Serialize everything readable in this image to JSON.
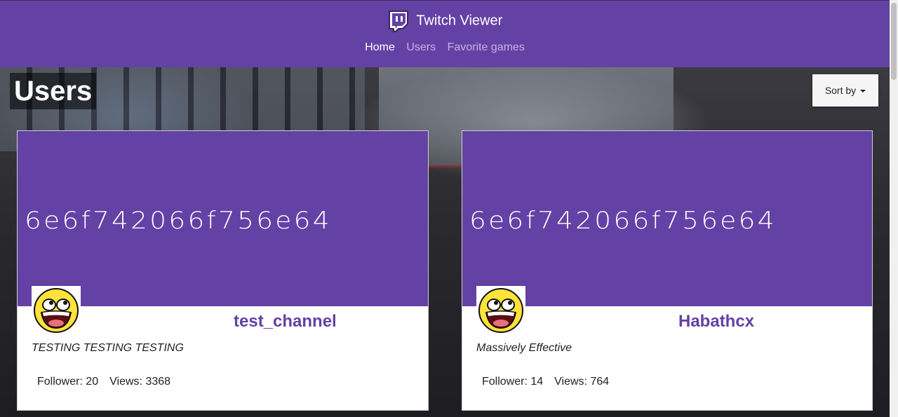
{
  "app": {
    "title": "Twitch Viewer"
  },
  "nav": {
    "items": [
      {
        "label": "Home",
        "active": true
      },
      {
        "label": "Users",
        "active": false
      },
      {
        "label": "Favorite games",
        "active": false
      }
    ]
  },
  "page": {
    "title": "Users",
    "sort_label": "Sort by"
  },
  "colors": {
    "brand": "#6441a5",
    "card_bg": "#ffffff"
  },
  "cards": [
    {
      "banner_text": "6e6f742066f756e64",
      "avatar_icon": "awesome-face-icon",
      "name": "test_channel",
      "description": "TESTING TESTING TESTING",
      "followers_text": "Follower: 20",
      "views_text": "Views: 3368"
    },
    {
      "banner_text": "6e6f742066f756e64",
      "avatar_icon": "awesome-face-icon",
      "name": "Habathcx",
      "description": "Massively Effective",
      "followers_text": "Follower: 14",
      "views_text": "Views: 764"
    }
  ]
}
